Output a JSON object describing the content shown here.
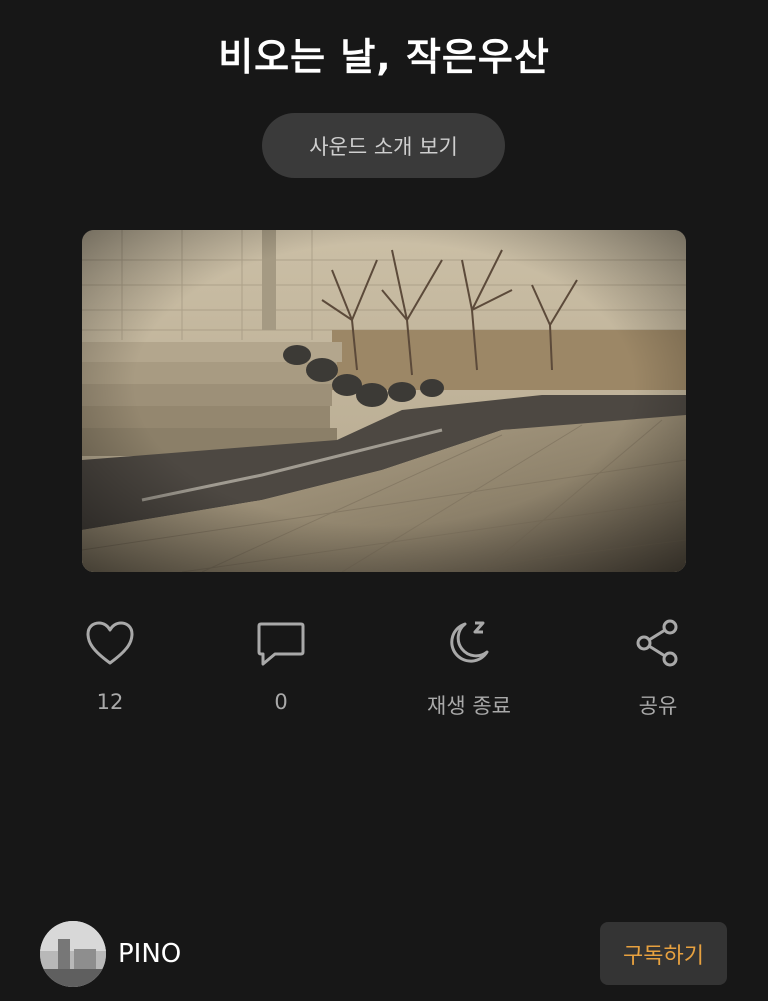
{
  "title": "비오는 날, 작은우산",
  "sound_intro_button": "사운드 소개 보기",
  "actions": [
    {
      "name": "like",
      "icon": "heart-icon",
      "label": "12"
    },
    {
      "name": "comment",
      "icon": "comment-icon",
      "label": "0"
    },
    {
      "name": "sleep-timer",
      "icon": "moon-sleep-icon",
      "label": "재생 종료"
    },
    {
      "name": "share",
      "icon": "share-icon",
      "label": "공유"
    }
  ],
  "creator": {
    "name": "PINO"
  },
  "subscribe_button": "구독하기",
  "colors": {
    "background": "#171717",
    "accent": "#e7a13f",
    "icon": "#a9a9a9"
  }
}
